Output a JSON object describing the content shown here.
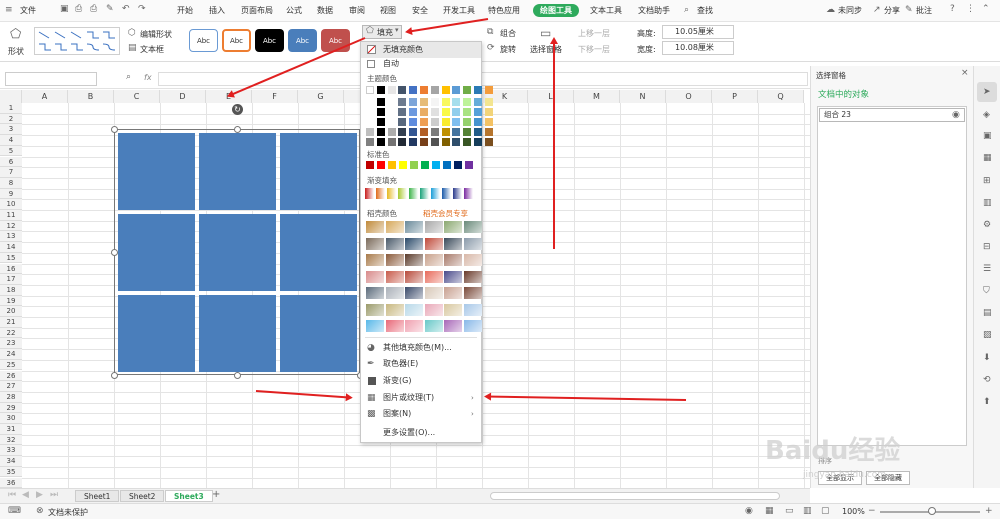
{
  "menu_tabs": [
    "文件",
    "开始",
    "插入",
    "页面布局",
    "公式",
    "数据",
    "审阅",
    "视图",
    "安全",
    "开发工具",
    "特色应用",
    "绘图工具",
    "文本工具",
    "文档助手",
    "查找"
  ],
  "active_tab": "绘图工具",
  "top_right": {
    "sync": "未同步",
    "share": "分享",
    "annotate": "批注"
  },
  "ribbon": {
    "shape": "形状",
    "edit_shape": "编辑形状",
    "text_box": "文本框",
    "style_label": "Abc",
    "fill": "填充",
    "combine": "组合",
    "rotate": "旋转",
    "select_pane": "选择窗格",
    "move_up": "上移一层",
    "move_down": "下移一层",
    "height_label": "高度:",
    "height_value": "10.05厘米",
    "width_label": "宽度:",
    "width_value": "10.08厘米"
  },
  "formula_bar": {
    "fx": "fx"
  },
  "columns": [
    "A",
    "B",
    "C",
    "D",
    "E",
    "F",
    "G",
    "H",
    "I",
    "J",
    "K",
    "L",
    "M",
    "N",
    "O",
    "P",
    "Q"
  ],
  "rows": [
    "1",
    "2",
    "3",
    "4",
    "5",
    "6",
    "7",
    "8",
    "9",
    "10",
    "11",
    "12",
    "13",
    "14",
    "15",
    "16",
    "17",
    "18",
    "19",
    "20",
    "21",
    "22",
    "23",
    "24",
    "25",
    "26",
    "27",
    "28",
    "29",
    "30",
    "31",
    "32",
    "33",
    "34",
    "35",
    "36"
  ],
  "fill_menu": {
    "no_fill": "无填充颜色",
    "auto": "自动",
    "theme_colors": "主题颜色",
    "standard_colors": "标准色",
    "gradient_fill": "渐变填充",
    "shell_colors": "稻壳颜色",
    "shell_member": "稻壳会员专享",
    "more_colors": "其他填充颜色(M)...",
    "eyedropper": "取色器(E)",
    "gradient": "渐变(G)",
    "picture_texture": "图片或纹理(T)",
    "pattern": "图案(N)",
    "more_settings": "更多设置(O)..."
  },
  "colors": {
    "theme_top": [
      "#ffffff",
      "#000000",
      "#e7e6e6",
      "#44546a",
      "#4472c4",
      "#ed7d31",
      "#a5a5a5",
      "#ffc000",
      "#5b9bd5",
      "#70ad47",
      "#2a7ab5",
      "#f39c3c"
    ],
    "standard": [
      "#c00000",
      "#ff0000",
      "#ffc000",
      "#ffff00",
      "#92d050",
      "#00b050",
      "#00b0f0",
      "#0070c0",
      "#002060",
      "#7030a0"
    ],
    "gradient": [
      "#c81e1e",
      "#e06a1a",
      "#e6b820",
      "#a8c830",
      "#3cb44a",
      "#1aa37a",
      "#1a9ed8",
      "#1a5aaa",
      "#2a3a8c",
      "#7a2aa0"
    ],
    "shape_fill": "#4a7ebb"
  },
  "pane": {
    "title": "选择窗格",
    "subtitle": "文档中的对象",
    "item": "组合 23",
    "show_all": "全部显示",
    "hide_all": "全部隐藏",
    "sort": "排序"
  },
  "sheets": [
    "Sheet1",
    "Sheet2",
    "Sheet3"
  ],
  "active_sheet": "Sheet3",
  "status": {
    "protect": "文档未保护",
    "zoom": "100%"
  },
  "watermark": "Baidu经验",
  "watermark_url": "jingyan.baidu.com"
}
